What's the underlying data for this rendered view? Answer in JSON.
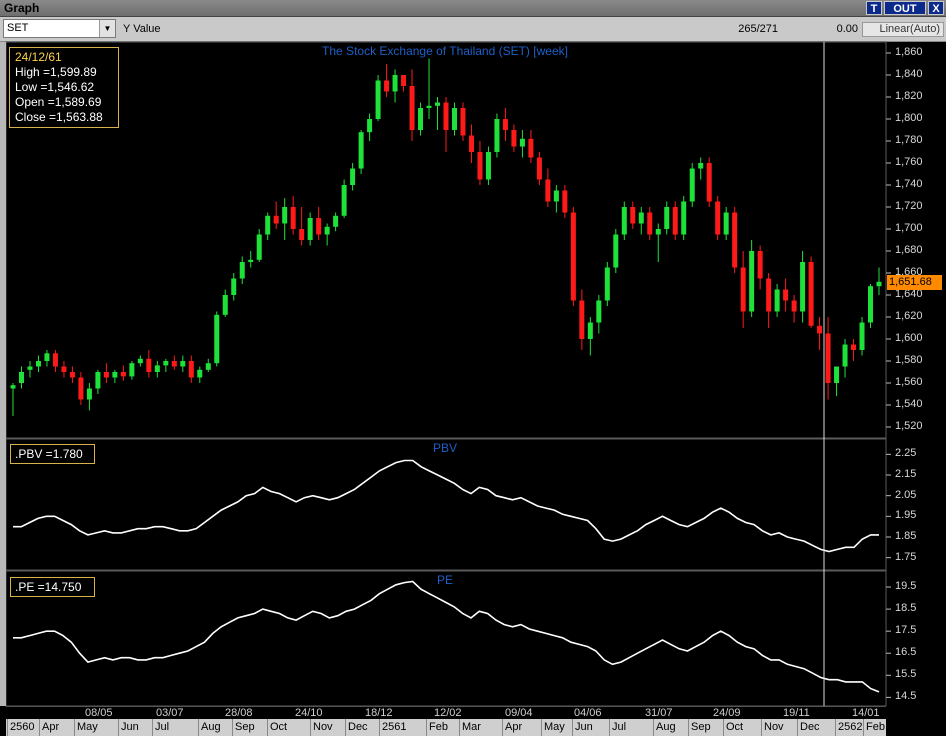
{
  "window": {
    "title": "Graph",
    "btn_t": "T",
    "btn_out": "OUT",
    "btn_x": "X"
  },
  "toolbar": {
    "symbol": "SET",
    "y_label": "Y Value",
    "range": "265/271",
    "value": "0.00",
    "scale": "Linear(Auto)"
  },
  "price_panel": {
    "title": "The Stock Exchange of Thailand (SET) [week]",
    "info": {
      "date": "24/12/61",
      "high": "High  =1,599.89",
      "low": "Low  =1,546.62",
      "open": "Open  =1,589.69",
      "close": "Close  =1,563.88"
    },
    "last_price": "1,651.68",
    "y_ticks": [
      "1,860",
      "1,840",
      "1,820",
      "1,800",
      "1,780",
      "1,760",
      "1,740",
      "1,720",
      "1,700",
      "1,680",
      "1,660",
      "1,640",
      "1,620",
      "1,600",
      "1,580",
      "1,560",
      "1,540",
      "1,520"
    ]
  },
  "pbv_panel": {
    "title": "PBV",
    "legend": ".PBV  =1.780",
    "y_ticks": [
      "2.25",
      "2.15",
      "2.05",
      "1.95",
      "1.85",
      "1.75"
    ]
  },
  "pe_panel": {
    "title": "PE",
    "legend": ".PE  =14.750",
    "y_ticks": [
      "19.5",
      "18.5",
      "17.5",
      "16.5",
      "15.5",
      "14.5"
    ]
  },
  "x_axis": {
    "top": [
      "08/05",
      "03/07",
      "28/08",
      "24/10",
      "18/12",
      "12/02",
      "09/04",
      "04/06",
      "31/07",
      "24/09",
      "19/11",
      "14/01"
    ],
    "bottom": [
      "2560",
      "Apr",
      "May",
      "Jun",
      "Jul",
      "Aug",
      "Sep",
      "Oct",
      "Nov",
      "Dec",
      "2561",
      "Feb",
      "Mar",
      "Apr",
      "May",
      "Jun",
      "Jul",
      "Aug",
      "Sep",
      "Oct",
      "Nov",
      "Dec",
      "2562",
      "Feb"
    ]
  },
  "chart_data": [
    {
      "type": "candlestick",
      "title": "The Stock Exchange of Thailand (SET) [week]",
      "ylim": [
        1510,
        1870
      ],
      "colors": {
        "up": "#1ee23a",
        "down": "#ff1a1a"
      },
      "candles": [
        [
          1555,
          1560,
          1530,
          1558
        ],
        [
          1560,
          1575,
          1555,
          1570
        ],
        [
          1572,
          1580,
          1565,
          1575
        ],
        [
          1575,
          1585,
          1570,
          1580
        ],
        [
          1580,
          1590,
          1575,
          1587
        ],
        [
          1587,
          1590,
          1570,
          1575
        ],
        [
          1575,
          1580,
          1565,
          1570
        ],
        [
          1570,
          1575,
          1560,
          1565
        ],
        [
          1565,
          1570,
          1540,
          1545
        ],
        [
          1545,
          1560,
          1535,
          1555
        ],
        [
          1555,
          1572,
          1550,
          1570
        ],
        [
          1570,
          1578,
          1560,
          1565
        ],
        [
          1565,
          1572,
          1560,
          1570
        ],
        [
          1570,
          1576,
          1562,
          1566
        ],
        [
          1566,
          1580,
          1563,
          1578
        ],
        [
          1578,
          1585,
          1575,
          1582
        ],
        [
          1582,
          1590,
          1565,
          1570
        ],
        [
          1570,
          1580,
          1565,
          1576
        ],
        [
          1576,
          1582,
          1570,
          1580
        ],
        [
          1580,
          1585,
          1572,
          1575
        ],
        [
          1575,
          1585,
          1570,
          1580
        ],
        [
          1580,
          1585,
          1560,
          1565
        ],
        [
          1565,
          1575,
          1560,
          1572
        ],
        [
          1572,
          1582,
          1570,
          1578
        ],
        [
          1578,
          1625,
          1575,
          1622
        ],
        [
          1622,
          1645,
          1620,
          1640
        ],
        [
          1640,
          1660,
          1635,
          1655
        ],
        [
          1655,
          1675,
          1650,
          1670
        ],
        [
          1670,
          1680,
          1665,
          1672
        ],
        [
          1672,
          1700,
          1670,
          1695
        ],
        [
          1695,
          1715,
          1690,
          1712
        ],
        [
          1712,
          1725,
          1700,
          1705
        ],
        [
          1705,
          1728,
          1690,
          1720
        ],
        [
          1720,
          1730,
          1695,
          1700
        ],
        [
          1700,
          1720,
          1685,
          1690
        ],
        [
          1690,
          1715,
          1685,
          1710
        ],
        [
          1710,
          1720,
          1690,
          1695
        ],
        [
          1695,
          1705,
          1685,
          1702
        ],
        [
          1702,
          1715,
          1698,
          1712
        ],
        [
          1712,
          1745,
          1710,
          1740
        ],
        [
          1740,
          1760,
          1735,
          1755
        ],
        [
          1755,
          1790,
          1750,
          1788
        ],
        [
          1788,
          1805,
          1780,
          1800
        ],
        [
          1800,
          1840,
          1798,
          1835
        ],
        [
          1835,
          1850,
          1820,
          1825
        ],
        [
          1825,
          1845,
          1815,
          1840
        ],
        [
          1840,
          1835,
          1825,
          1830
        ],
        [
          1830,
          1845,
          1780,
          1790
        ],
        [
          1790,
          1815,
          1785,
          1810
        ],
        [
          1810,
          1855,
          1800,
          1812
        ],
        [
          1812,
          1820,
          1790,
          1815
        ],
        [
          1815,
          1820,
          1770,
          1790
        ],
        [
          1790,
          1815,
          1785,
          1810
        ],
        [
          1810,
          1815,
          1780,
          1785
        ],
        [
          1785,
          1795,
          1760,
          1770
        ],
        [
          1770,
          1780,
          1740,
          1745
        ],
        [
          1745,
          1775,
          1740,
          1770
        ],
        [
          1770,
          1805,
          1765,
          1800
        ],
        [
          1800,
          1810,
          1780,
          1790
        ],
        [
          1790,
          1795,
          1770,
          1775
        ],
        [
          1775,
          1790,
          1765,
          1782
        ],
        [
          1782,
          1790,
          1760,
          1765
        ],
        [
          1765,
          1770,
          1740,
          1745
        ],
        [
          1745,
          1755,
          1720,
          1725
        ],
        [
          1725,
          1740,
          1715,
          1735
        ],
        [
          1735,
          1740,
          1710,
          1715
        ],
        [
          1715,
          1720,
          1630,
          1635
        ],
        [
          1635,
          1645,
          1590,
          1600
        ],
        [
          1600,
          1620,
          1585,
          1615
        ],
        [
          1615,
          1640,
          1605,
          1635
        ],
        [
          1635,
          1670,
          1630,
          1665
        ],
        [
          1665,
          1700,
          1660,
          1695
        ],
        [
          1695,
          1725,
          1690,
          1720
        ],
        [
          1720,
          1725,
          1700,
          1705
        ],
        [
          1705,
          1720,
          1695,
          1715
        ],
        [
          1715,
          1720,
          1690,
          1695
        ],
        [
          1695,
          1705,
          1670,
          1700
        ],
        [
          1700,
          1725,
          1695,
          1720
        ],
        [
          1720,
          1725,
          1690,
          1695
        ],
        [
          1695,
          1730,
          1690,
          1725
        ],
        [
          1725,
          1760,
          1720,
          1755
        ],
        [
          1755,
          1765,
          1745,
          1760
        ],
        [
          1760,
          1765,
          1720,
          1725
        ],
        [
          1725,
          1730,
          1690,
          1695
        ],
        [
          1695,
          1720,
          1690,
          1715
        ],
        [
          1715,
          1720,
          1660,
          1665
        ],
        [
          1665,
          1680,
          1610,
          1625
        ],
        [
          1625,
          1690,
          1620,
          1680
        ],
        [
          1680,
          1685,
          1645,
          1655
        ],
        [
          1655,
          1660,
          1610,
          1625
        ],
        [
          1625,
          1650,
          1620,
          1645
        ],
        [
          1645,
          1655,
          1625,
          1635
        ],
        [
          1635,
          1640,
          1615,
          1625
        ],
        [
          1625,
          1680,
          1615,
          1670
        ],
        [
          1670,
          1675,
          1610,
          1612
        ],
        [
          1612,
          1620,
          1590,
          1605
        ],
        [
          1605,
          1620,
          1545,
          1560
        ],
        [
          1560,
          1575,
          1548,
          1575
        ],
        [
          1575,
          1600,
          1565,
          1595
        ],
        [
          1595,
          1600,
          1580,
          1590
        ],
        [
          1590,
          1620,
          1585,
          1615
        ],
        [
          1615,
          1650,
          1610,
          1648
        ],
        [
          1648,
          1665,
          1640,
          1652
        ]
      ]
    },
    {
      "type": "line",
      "title": "PBV",
      "ylim": [
        1.7,
        2.3
      ],
      "series": [
        {
          "name": ".PBV",
          "color": "#ffffff",
          "values": [
            1.9,
            1.9,
            1.92,
            1.94,
            1.95,
            1.95,
            1.93,
            1.91,
            1.88,
            1.86,
            1.87,
            1.88,
            1.87,
            1.87,
            1.88,
            1.89,
            1.89,
            1.9,
            1.9,
            1.89,
            1.88,
            1.88,
            1.89,
            1.92,
            1.95,
            1.98,
            2.0,
            2.02,
            2.05,
            2.06,
            2.09,
            2.07,
            2.06,
            2.04,
            2.02,
            2.04,
            2.05,
            2.04,
            2.03,
            2.04,
            2.06,
            2.08,
            2.11,
            2.14,
            2.17,
            2.19,
            2.21,
            2.22,
            2.22,
            2.19,
            2.17,
            2.15,
            2.13,
            2.11,
            2.08,
            2.06,
            2.09,
            2.08,
            2.05,
            2.04,
            2.03,
            2.04,
            2.02,
            2.0,
            1.99,
            1.98,
            1.96,
            1.95,
            1.94,
            1.93,
            1.89,
            1.84,
            1.83,
            1.84,
            1.86,
            1.88,
            1.91,
            1.93,
            1.95,
            1.93,
            1.91,
            1.9,
            1.92,
            1.94,
            1.97,
            1.99,
            1.97,
            1.94,
            1.92,
            1.91,
            1.88,
            1.86,
            1.87,
            1.85,
            1.84,
            1.83,
            1.81,
            1.79,
            1.78,
            1.79,
            1.8,
            1.8,
            1.84,
            1.86,
            1.86
          ]
        }
      ]
    },
    {
      "type": "line",
      "title": "PE",
      "ylim": [
        14.2,
        20.0
      ],
      "series": [
        {
          "name": ".PE",
          "color": "#ffffff",
          "values": [
            17.2,
            17.2,
            17.3,
            17.4,
            17.5,
            17.5,
            17.3,
            17.0,
            16.5,
            16.1,
            16.2,
            16.3,
            16.2,
            16.3,
            16.3,
            16.2,
            16.2,
            16.3,
            16.3,
            16.4,
            16.5,
            16.6,
            16.8,
            17.0,
            17.4,
            17.7,
            17.9,
            18.1,
            18.2,
            18.3,
            18.5,
            18.4,
            18.3,
            18.1,
            18.0,
            18.2,
            18.4,
            18.3,
            18.1,
            18.2,
            18.4,
            18.5,
            18.7,
            18.9,
            19.2,
            19.4,
            19.6,
            19.7,
            19.75,
            19.4,
            19.2,
            19.0,
            18.8,
            18.6,
            18.3,
            18.1,
            18.4,
            18.3,
            18.0,
            17.8,
            17.7,
            17.8,
            17.6,
            17.5,
            17.4,
            17.3,
            17.2,
            17.0,
            16.9,
            16.8,
            16.6,
            16.2,
            16.0,
            16.1,
            16.3,
            16.5,
            16.7,
            16.9,
            17.1,
            16.9,
            16.7,
            16.6,
            16.8,
            17.0,
            17.3,
            17.5,
            17.3,
            17.0,
            16.8,
            16.7,
            16.4,
            16.2,
            16.2,
            16.0,
            15.9,
            15.8,
            15.6,
            15.4,
            15.3,
            15.3,
            15.2,
            15.2,
            15.2,
            14.9,
            14.75
          ]
        }
      ]
    }
  ]
}
